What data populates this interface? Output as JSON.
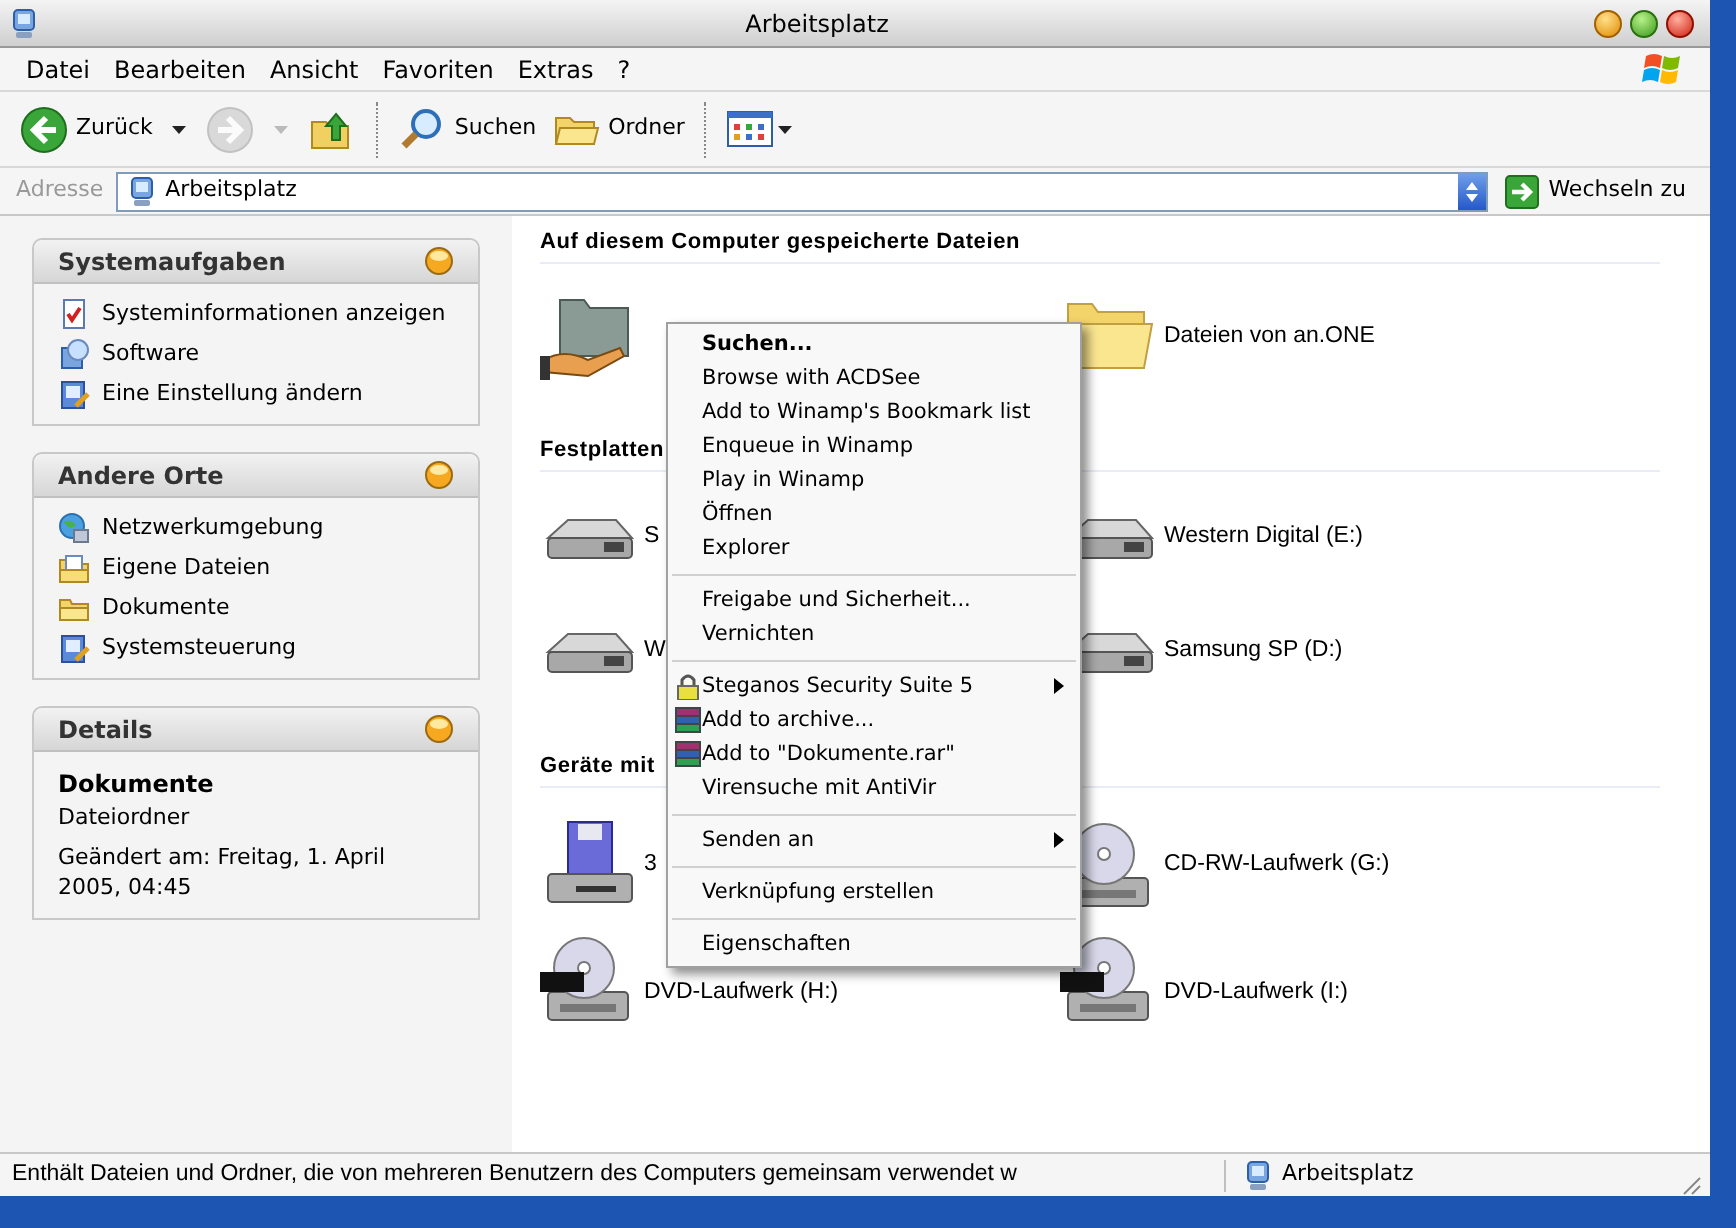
{
  "window": {
    "title": "Arbeitsplatz"
  },
  "menu_bar": [
    "Datei",
    "Bearbeiten",
    "Ansicht",
    "Favoriten",
    "Extras",
    "?"
  ],
  "toolbar": [
    {
      "kind": "back",
      "label": "Zurück",
      "disabled": false
    },
    {
      "kind": "forward",
      "disabled": true
    },
    {
      "kind": "up"
    },
    {
      "kind": "search",
      "label": "Suchen"
    },
    {
      "kind": "folders",
      "label": "Ordner"
    },
    {
      "kind": "views"
    }
  ],
  "address_bar": {
    "label": "Adresse",
    "value": "Arbeitsplatz",
    "go_label": "Wechseln zu"
  },
  "sidebar": {
    "panels": [
      {
        "title": "Systemaufgaben",
        "links": [
          {
            "kind": "info",
            "label": "Systeminformationen anzeigen"
          },
          {
            "kind": "software",
            "label": "Software"
          },
          {
            "kind": "control",
            "label": "Eine Einstellung ändern"
          }
        ]
      },
      {
        "title": "Andere Orte",
        "links": [
          {
            "kind": "network",
            "label": "Netzwerkumgebung"
          },
          {
            "kind": "docs",
            "label": "Eigene Dateien"
          },
          {
            "kind": "folder",
            "label": "Dokumente"
          },
          {
            "kind": "control",
            "label": "Systemsteuerung"
          }
        ]
      }
    ],
    "details": {
      "title": "Details",
      "name": "Dokumente",
      "type": "Dateiordner",
      "modified": "Geändert am: Freitag, 1. April 2005, 04:45"
    }
  },
  "sections": [
    {
      "title": "Auf diesem Computer gespeicherte Dateien",
      "items": [
        {
          "kind": "shared-folder"
        },
        {
          "kind": "folder",
          "label": "Dateien von an.ONE"
        }
      ]
    },
    {
      "title": "Festplatten",
      "items": [
        {
          "kind": "drive",
          "label": "S"
        },
        {
          "kind": "drive",
          "label": "Western Digital (E:)"
        },
        {
          "kind": "drive",
          "label": "W"
        },
        {
          "kind": "drive",
          "label": "Samsung SP (D:)"
        }
      ]
    },
    {
      "title": "Geräte mit",
      "items": [
        {
          "kind": "floppy",
          "label": "3"
        },
        {
          "kind": "cdrom",
          "label": "CD-RW-Laufwerk (G:)"
        },
        {
          "kind": "dvd",
          "label": "DVD-Laufwerk (H:)"
        },
        {
          "kind": "dvd",
          "label": "DVD-Laufwerk (I:)"
        }
      ]
    }
  ],
  "context_menu": [
    [
      {
        "label": "Suchen...",
        "default": true,
        "submenu": false
      },
      {
        "label": "Browse with ACDSee",
        "default": false,
        "submenu": false
      },
      {
        "label": "Add to Winamp's Bookmark list",
        "default": false,
        "submenu": false
      },
      {
        "label": "Enqueue in Winamp",
        "default": false,
        "submenu": false
      },
      {
        "label": "Play in Winamp",
        "default": false,
        "submenu": false
      },
      {
        "label": "Öffnen",
        "default": false,
        "submenu": false
      },
      {
        "label": "Explorer",
        "default": false,
        "submenu": false
      }
    ],
    [
      {
        "label": "Freigabe und Sicherheit...",
        "default": false,
        "submenu": false
      },
      {
        "label": "Vernichten",
        "default": false,
        "submenu": false
      }
    ],
    [
      {
        "label": "Steganos Security Suite 5",
        "default": false,
        "submenu": true,
        "kind": "lock"
      },
      {
        "label": "Add to archive...",
        "default": false,
        "submenu": false,
        "kind": "archive"
      },
      {
        "label": "Add to \"Dokumente.rar\"",
        "default": false,
        "submenu": false,
        "kind": "archive"
      },
      {
        "label": "Virensuche mit AntiVir",
        "default": false,
        "submenu": false
      }
    ],
    [
      {
        "label": "Senden an",
        "default": false,
        "submenu": true
      }
    ],
    [
      {
        "label": "Verknüpfung erstellen",
        "default": false,
        "submenu": false
      }
    ],
    [
      {
        "label": "Eigenschaften",
        "default": false,
        "submenu": false
      }
    ]
  ],
  "status_bar": {
    "text": "Enthält Dateien und Ordner, die von mehreren Benutzern des Computers gemeinsam verwendet w",
    "location": "Arbeitsplatz"
  }
}
